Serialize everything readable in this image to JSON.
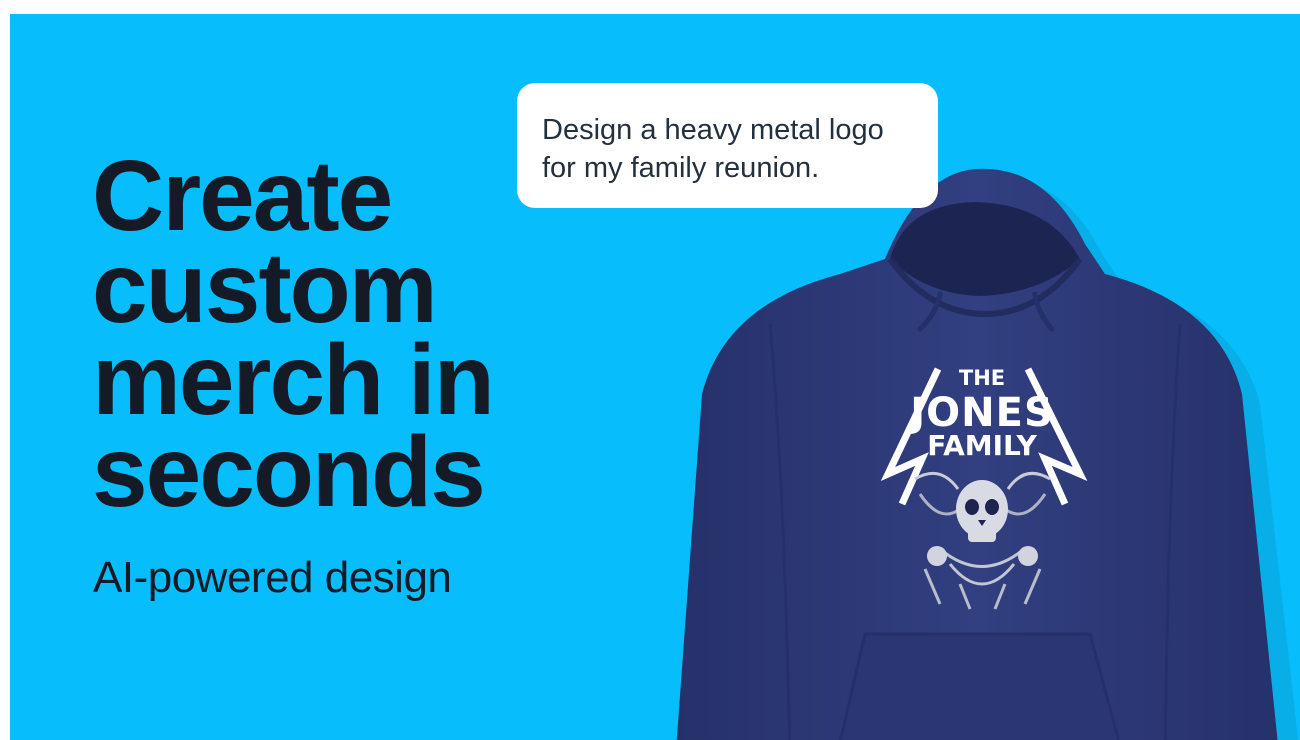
{
  "headline": {
    "lines": [
      "Create",
      "custom",
      "merch in",
      "seconds"
    ]
  },
  "subheadline": "AI-powered design",
  "prompt_bubble": {
    "lines": [
      "Design a heavy metal logo",
      "for my family reunion."
    ]
  },
  "hoodie_print": {
    "top": "THE",
    "middle": "JONES",
    "bottom": "FAMILY"
  },
  "colors": {
    "background": "#08bdfb",
    "headline_text": "#151b26",
    "hoodie": "#2d3a78",
    "print": "#ffffff"
  }
}
